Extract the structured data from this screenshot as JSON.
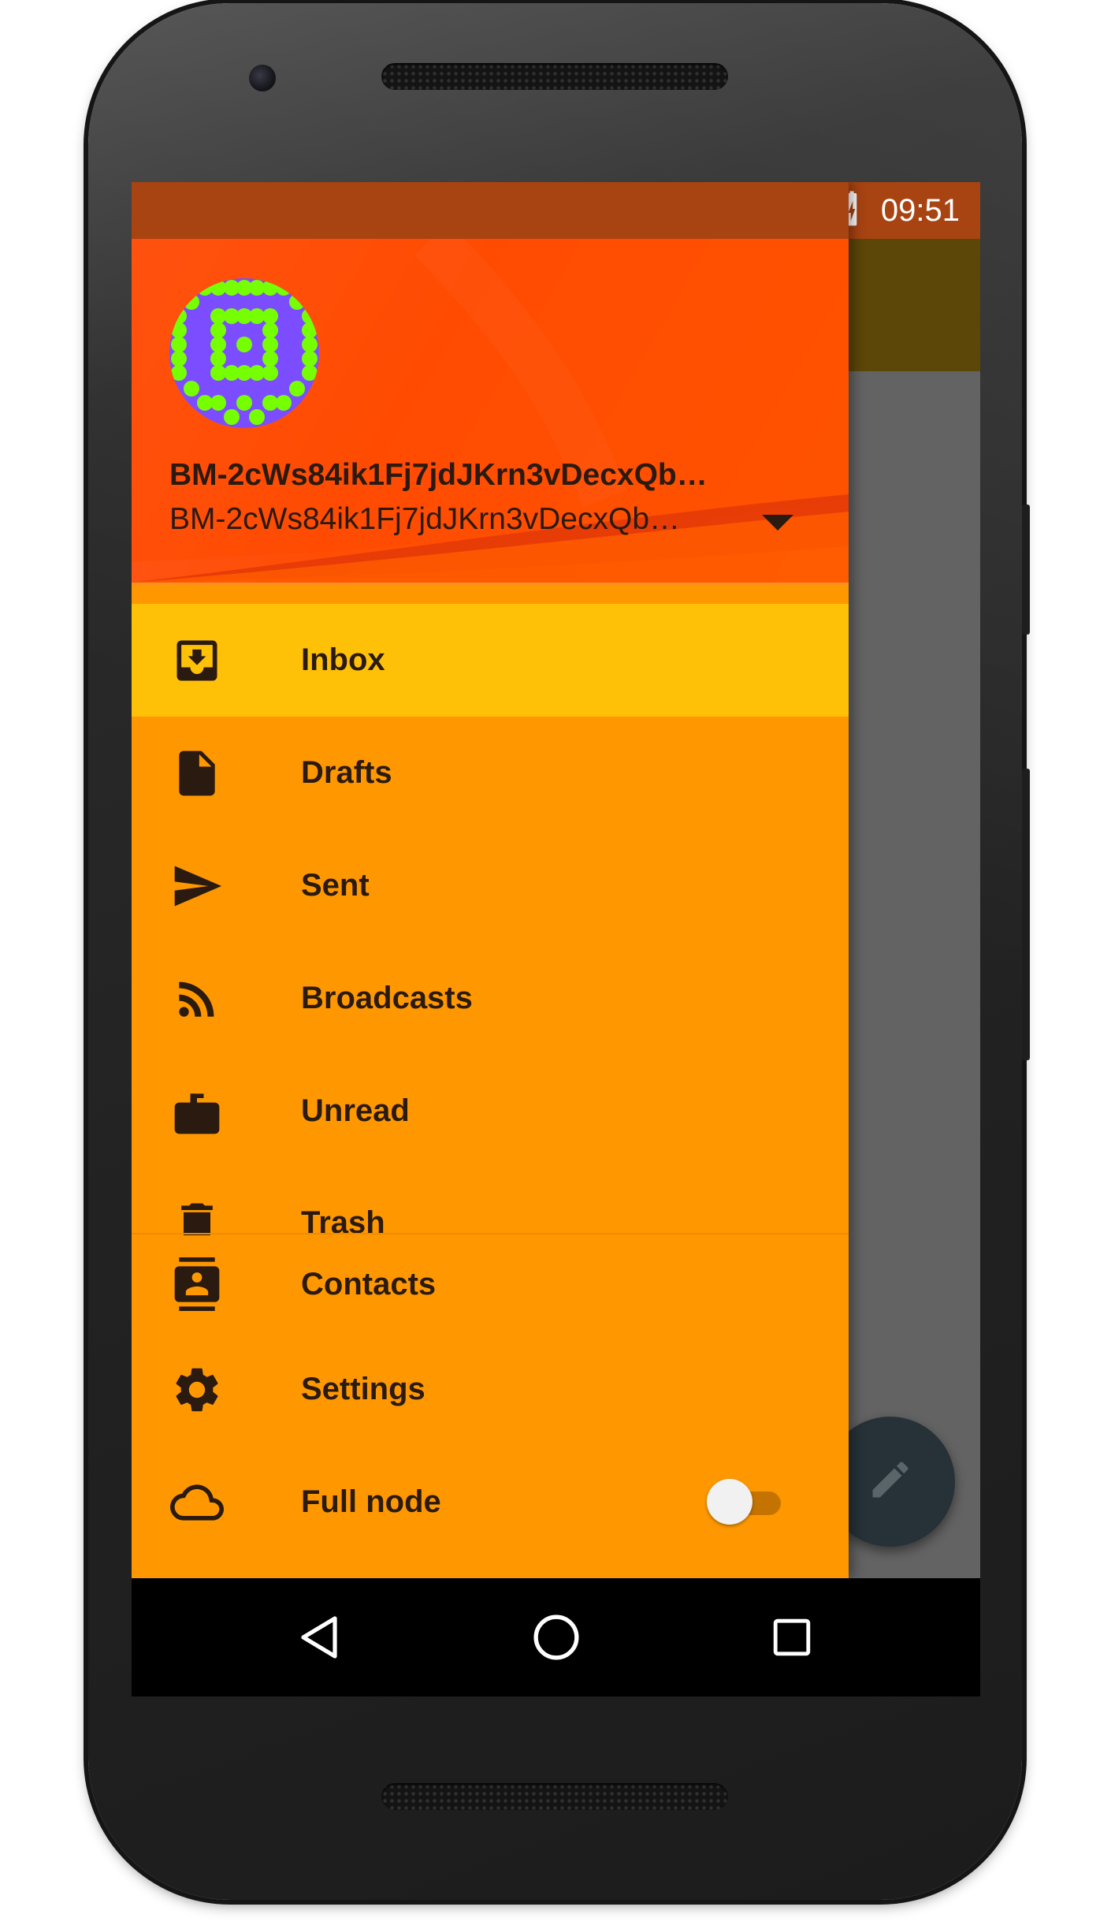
{
  "status_bar": {
    "time": "09:51",
    "icons": [
      "bluetooth-icon",
      "vibrate-icon",
      "wifi-icon",
      "cell-signal-icon",
      "battery-charging-icon"
    ]
  },
  "drawer": {
    "account": {
      "name": "BM-2cWs84ik1Fj7jdJKrn3vDecxQb…",
      "address": "BM-2cWs84ik1Fj7jdJKrn3vDecxQb…",
      "avatar_icon": "identicon-avatar",
      "dropdown_icon": "arrow-drop-down-icon"
    },
    "items": [
      {
        "label": "Inbox",
        "icon": "inbox-icon",
        "selected": true
      },
      {
        "label": "Drafts",
        "icon": "draft-icon",
        "selected": false
      },
      {
        "label": "Sent",
        "icon": "send-icon",
        "selected": false
      },
      {
        "label": "Broadcasts",
        "icon": "rss-feed-icon",
        "selected": false
      },
      {
        "label": "Unread",
        "icon": "mailbox-icon",
        "selected": false
      },
      {
        "label": "Trash",
        "icon": "trash-icon",
        "selected": false
      }
    ],
    "bottom_items": [
      {
        "label": "Contacts",
        "icon": "contacts-icon"
      },
      {
        "label": "Settings",
        "icon": "settings-icon"
      },
      {
        "label": "Full node",
        "icon": "cloud-icon",
        "toggle_on": false
      }
    ]
  },
  "fab": {
    "icon": "edit-icon"
  },
  "system_nav": {
    "back": "back-icon",
    "home": "home-icon",
    "recents": "recents-icon"
  },
  "colors": {
    "drawer_bg": "#ff9800",
    "selected_item_bg": "#ffc107",
    "header_bg": "#ff4d05",
    "status_bar": "#a84312",
    "fab_bg": "#263238",
    "avatar_bg": "#7c4dff",
    "identicon_dots": "#76ff03"
  }
}
